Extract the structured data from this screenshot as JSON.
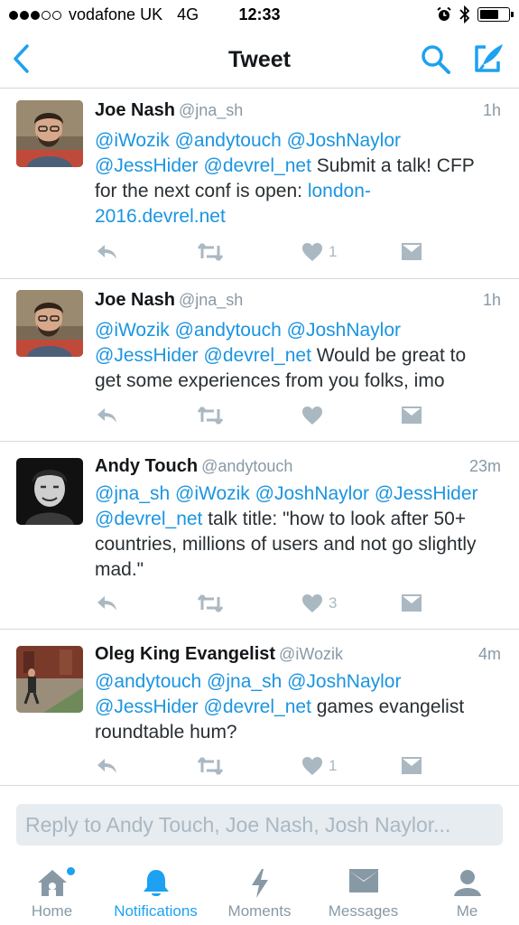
{
  "statusbar": {
    "carrier": "vodafone UK",
    "network": "4G",
    "time": "12:33",
    "signal_filled": 3,
    "signal_total": 5,
    "battery_level": 0.7
  },
  "navbar": {
    "title": "Tweet",
    "accent_color": "#1da1f2"
  },
  "tweets": [
    {
      "name": "Joe Nash",
      "handle": "@jna_sh",
      "time": "1h",
      "mentions": "@iWozik @andytouch @JoshNaylor @JessHider @devrel_net",
      "text": " Submit a talk! CFP for the next conf is open: ",
      "link": "london-2016.devrel.net",
      "likes": "1"
    },
    {
      "name": "Joe Nash",
      "handle": "@jna_sh",
      "time": "1h",
      "mentions": "@iWozik @andytouch @JoshNaylor @JessHider @devrel_net",
      "text": " Would be great to get some experiences from you folks, imo",
      "likes": ""
    },
    {
      "name": "Andy Touch",
      "handle": "@andytouch",
      "time": "23m",
      "mentions": "@jna_sh @iWozik @JoshNaylor @JessHider @devrel_net",
      "text": " talk title: \"how to look after 50+ countries, millions of users and not go slightly mad.\"",
      "likes": "3"
    },
    {
      "name": "Oleg King Evangelist",
      "handle": "@iWozik",
      "time": "4m",
      "mentions": "@andytouch @jna_sh @JoshNaylor @JessHider @devrel_net",
      "text": " games evangelist roundtable hum?",
      "likes": "1"
    }
  ],
  "reply": {
    "placeholder": "Reply to Andy Touch, Joe Nash, Josh Naylor..."
  },
  "tabs": [
    {
      "label": "Home",
      "icon": "home-icon"
    },
    {
      "label": "Notifications",
      "icon": "bell-icon"
    },
    {
      "label": "Moments",
      "icon": "lightning-icon"
    },
    {
      "label": "Messages",
      "icon": "envelope-icon"
    },
    {
      "label": "Me",
      "icon": "person-icon"
    }
  ]
}
